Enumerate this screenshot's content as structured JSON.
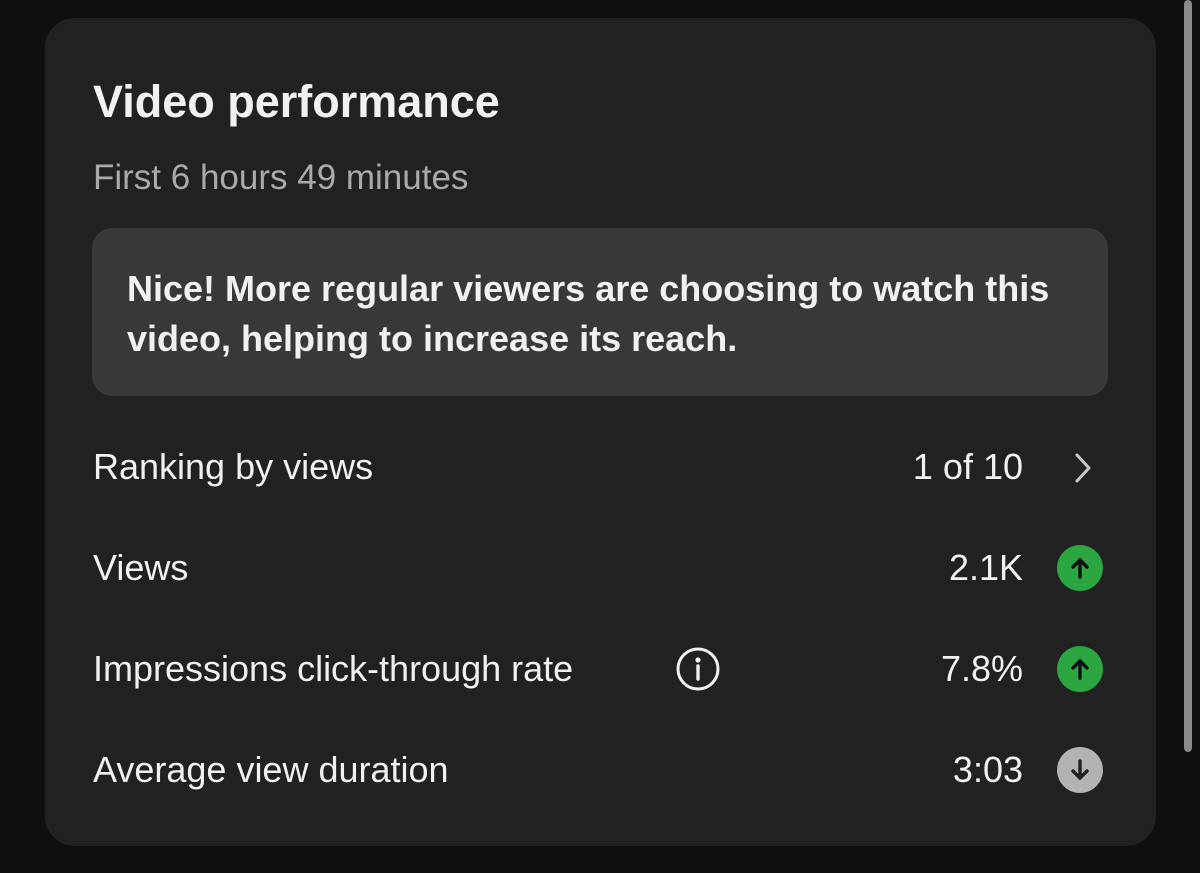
{
  "card": {
    "title": "Video performance",
    "subtitle": "First 6 hours 49 minutes",
    "insight": "Nice! More regular viewers are choosing to watch this video, helping to increase its reach."
  },
  "metrics": [
    {
      "label": "Ranking by views",
      "value": "1 of 10",
      "indicator": "chevron-right-icon"
    },
    {
      "label": "Views",
      "value": "2.1K",
      "indicator": "arrow-up-icon",
      "trend": "up",
      "trend_color": "#2ba640"
    },
    {
      "label": "Impressions click-through rate",
      "value": "7.8%",
      "indicator": "arrow-up-icon",
      "trend": "up",
      "trend_color": "#2ba640",
      "has_info_icon": true
    },
    {
      "label": "Average view duration",
      "value": "3:03",
      "indicator": "arrow-down-icon",
      "trend": "down",
      "trend_color": "#b3b3b3"
    }
  ],
  "colors": {
    "background": "#0f0f0f",
    "card": "#212121",
    "insight_box": "#383838",
    "trend_up": "#2ba640",
    "trend_down": "#b3b3b3"
  }
}
